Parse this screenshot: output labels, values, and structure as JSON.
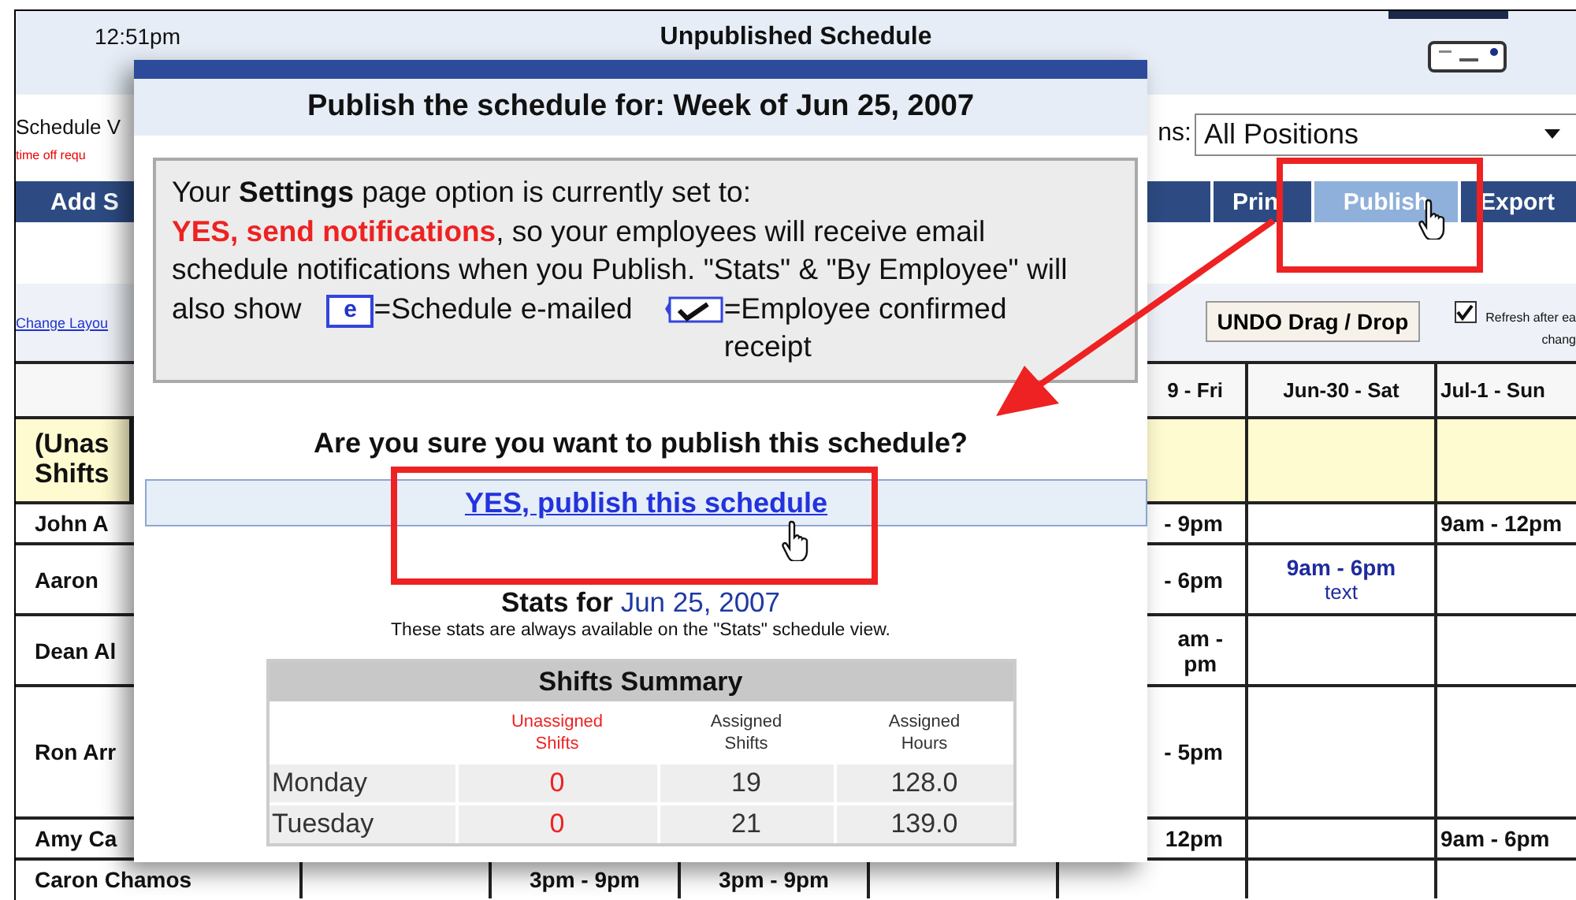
{
  "header": {
    "time": "12:51pm",
    "title": "Unpublished Schedule"
  },
  "toolbar": {
    "view_label": "Schedule V",
    "alert": "time off requ",
    "positions_label": "ns:",
    "positions_value": "All Positions"
  },
  "nav": [
    {
      "label": "Add S",
      "selected": false
    },
    {
      "label": "Prin",
      "selected": false
    },
    {
      "label": "Publish",
      "selected": true
    },
    {
      "label": "Export",
      "selected": false
    }
  ],
  "change_layout_link": "Change Layou",
  "undo_button": "UNDO Drag / Drop",
  "refresh": {
    "checked": true,
    "label": "Refresh after ea",
    "label_2": "chang"
  },
  "schedule": {
    "columns": {
      "fri": "9 - Fri",
      "sat": "Jun-30 - Sat",
      "sun": "Jul-1 - Sun"
    },
    "rows": [
      {
        "name": "(Unas Shifts",
        "kind": "unassigned",
        "cells": {}
      },
      {
        "name": "John A",
        "kind": "employee",
        "cells": {
          "fri": {
            "lines": [
              "- 9pm"
            ]
          },
          "sun": {
            "lines": [
              "9am - 12pm"
            ]
          }
        }
      },
      {
        "name": "Aaron",
        "kind": "employee",
        "cells": {
          "fri": {
            "lines": [
              "- 6pm"
            ]
          },
          "sat": {
            "lines": [
              "9am - 6pm",
              "text"
            ],
            "color": "#1f2a9c"
          }
        }
      },
      {
        "name": "Dean Al",
        "kind": "employee",
        "cells": {
          "fri": {
            "lines": [
              "am -",
              "pm"
            ]
          }
        }
      },
      {
        "name": "Ron Arr",
        "kind": "employee",
        "cells": {
          "fri": {
            "lines": [
              "- 5pm"
            ]
          }
        }
      },
      {
        "name": "Amy Ca",
        "kind": "employee",
        "cells": {
          "fri": {
            "lines": [
              "12pm"
            ]
          },
          "sun": {
            "lines": [
              "9am - 6pm"
            ]
          }
        }
      },
      {
        "name": "Caron Chamos",
        "kind": "employee",
        "cells": {
          "tue": {
            "lines": [
              "3pm - 9pm"
            ]
          },
          "wed": {
            "lines": [
              "3pm - 9pm"
            ]
          }
        }
      }
    ]
  },
  "dialog": {
    "heading": "Publish the schedule for: Week of Jun 25, 2007",
    "notice": "Your **Settings** page option is currently set to:\n**YES, send notifications**, so your employees will receive email schedule notifications when you Publish. \"Stats\" & \"By Employee\" will",
    "legend_intro": "also show",
    "emailed_icon_letter": "e",
    "emailed_legend": "=Schedule e-mailed",
    "confirmed_legend": "=Employee confirmed receipt",
    "question": "Are you sure you want to publish this schedule?",
    "confirm_link": "YES, publish this schedule",
    "stats_title": "Stats for",
    "stats_date": "Jun 25, 2007",
    "stats_note": "These stats are always available on the \"Stats\" schedule view.",
    "summary": {
      "title": "Shifts Summary",
      "columns": [
        {
          "label": "Unassigned Shifts",
          "kind": "unassigned"
        },
        {
          "label": "Assigned Shifts",
          "kind": "assigned"
        },
        {
          "label": "Assigned Hours",
          "kind": "assigned"
        }
      ],
      "rows": [
        {
          "day": "Monday",
          "values": [
            "0",
            "19",
            "128.0"
          ]
        },
        {
          "day": "Tuesday",
          "values": [
            "0",
            "21",
            "139.0"
          ]
        }
      ]
    }
  }
}
